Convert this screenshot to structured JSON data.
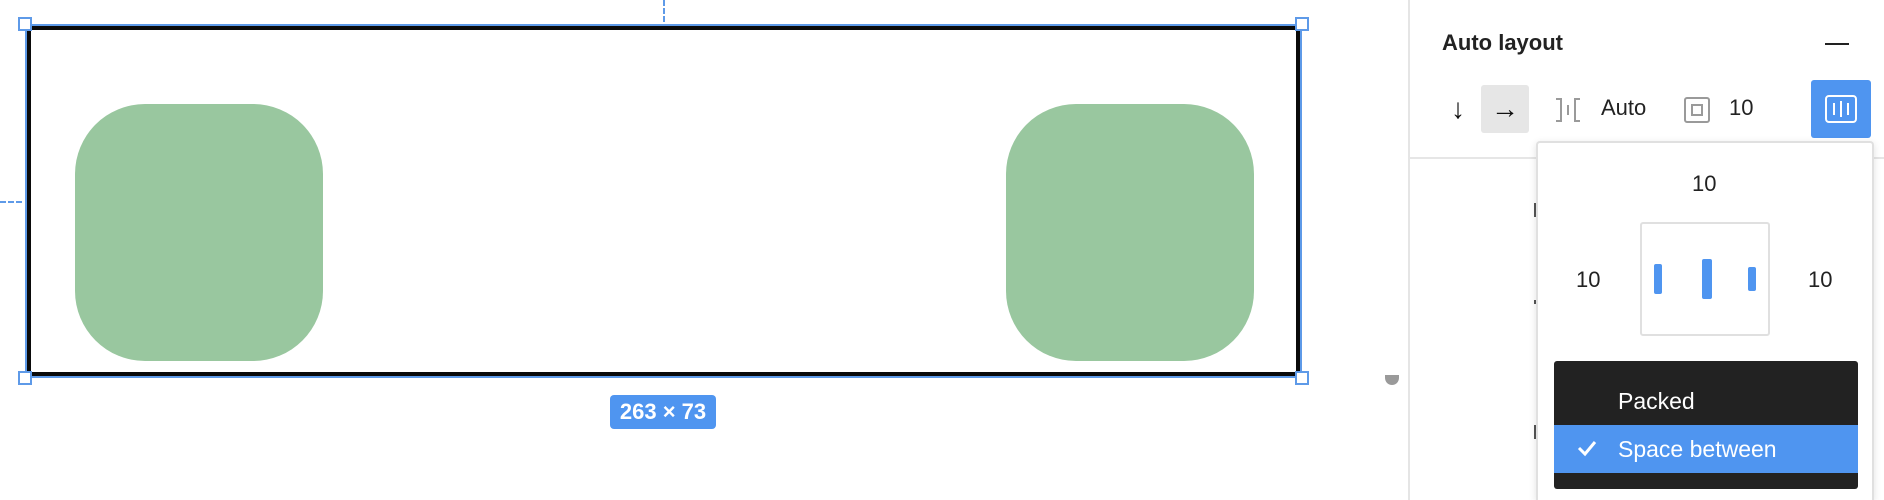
{
  "canvas": {
    "size_badge": "263 × 73"
  },
  "panel": {
    "section_title": "Auto layout",
    "direction": {
      "vertical_icon": "arrow-down",
      "horizontal_icon": "arrow-right",
      "vertical_glyph": "↓",
      "horizontal_glyph": "→",
      "selected": "horizontal"
    },
    "spacing": {
      "icon": "spacing-between-icon",
      "value": "Auto"
    },
    "padding": {
      "icon": "padding-icon",
      "value": "10"
    },
    "alignment_icon": "distribute-alignment-icon"
  },
  "popup": {
    "padding_top": "10",
    "padding_left": "10",
    "padding_right": "10",
    "spacing_mode_options": [
      {
        "label": "Packed",
        "selected": false
      },
      {
        "label": "Space between",
        "selected": true
      }
    ]
  },
  "colors": {
    "accent": "#4f95f0",
    "child_fill": "#99c79f",
    "frame_stroke": "#0a0a0a",
    "dropdown_bg": "#222222"
  }
}
